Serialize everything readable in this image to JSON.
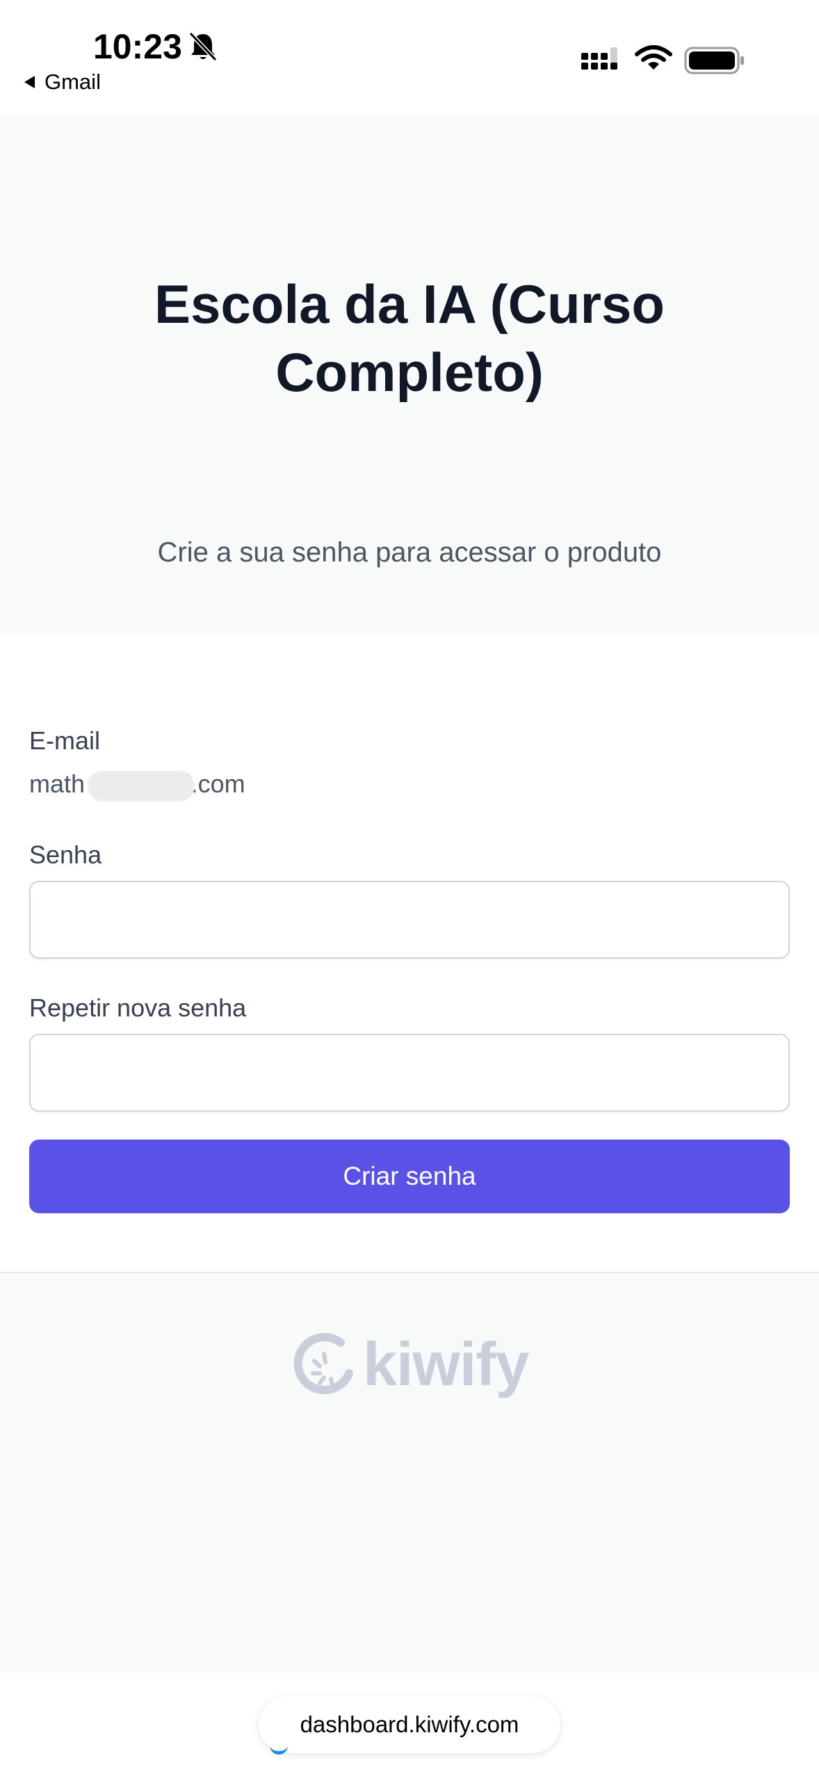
{
  "status_bar": {
    "time": "10:23",
    "back_app": "Gmail",
    "icons": [
      "bell-slash-icon",
      "signal-icon",
      "wifi-icon",
      "battery-icon"
    ]
  },
  "hero": {
    "title": "Escola da IA (Curso Completo)",
    "subtitle": "Crie a sua senha para acessar o produto"
  },
  "form": {
    "email_label": "E-mail",
    "email_value": "math          a@gmail.com",
    "password_label": "Senha",
    "password_value": "",
    "repeat_label": "Repetir nova senha",
    "repeat_value": "",
    "submit_label": "Criar senha"
  },
  "brand": {
    "wordmark": "kiwify",
    "icon": "kiwify-mark-icon"
  },
  "browser": {
    "url": "dashboard.kiwify.com"
  },
  "colors": {
    "primary": "#5a52e6",
    "background": "#f8f9f9",
    "title": "#111827",
    "logo": "#c8cfdb"
  }
}
